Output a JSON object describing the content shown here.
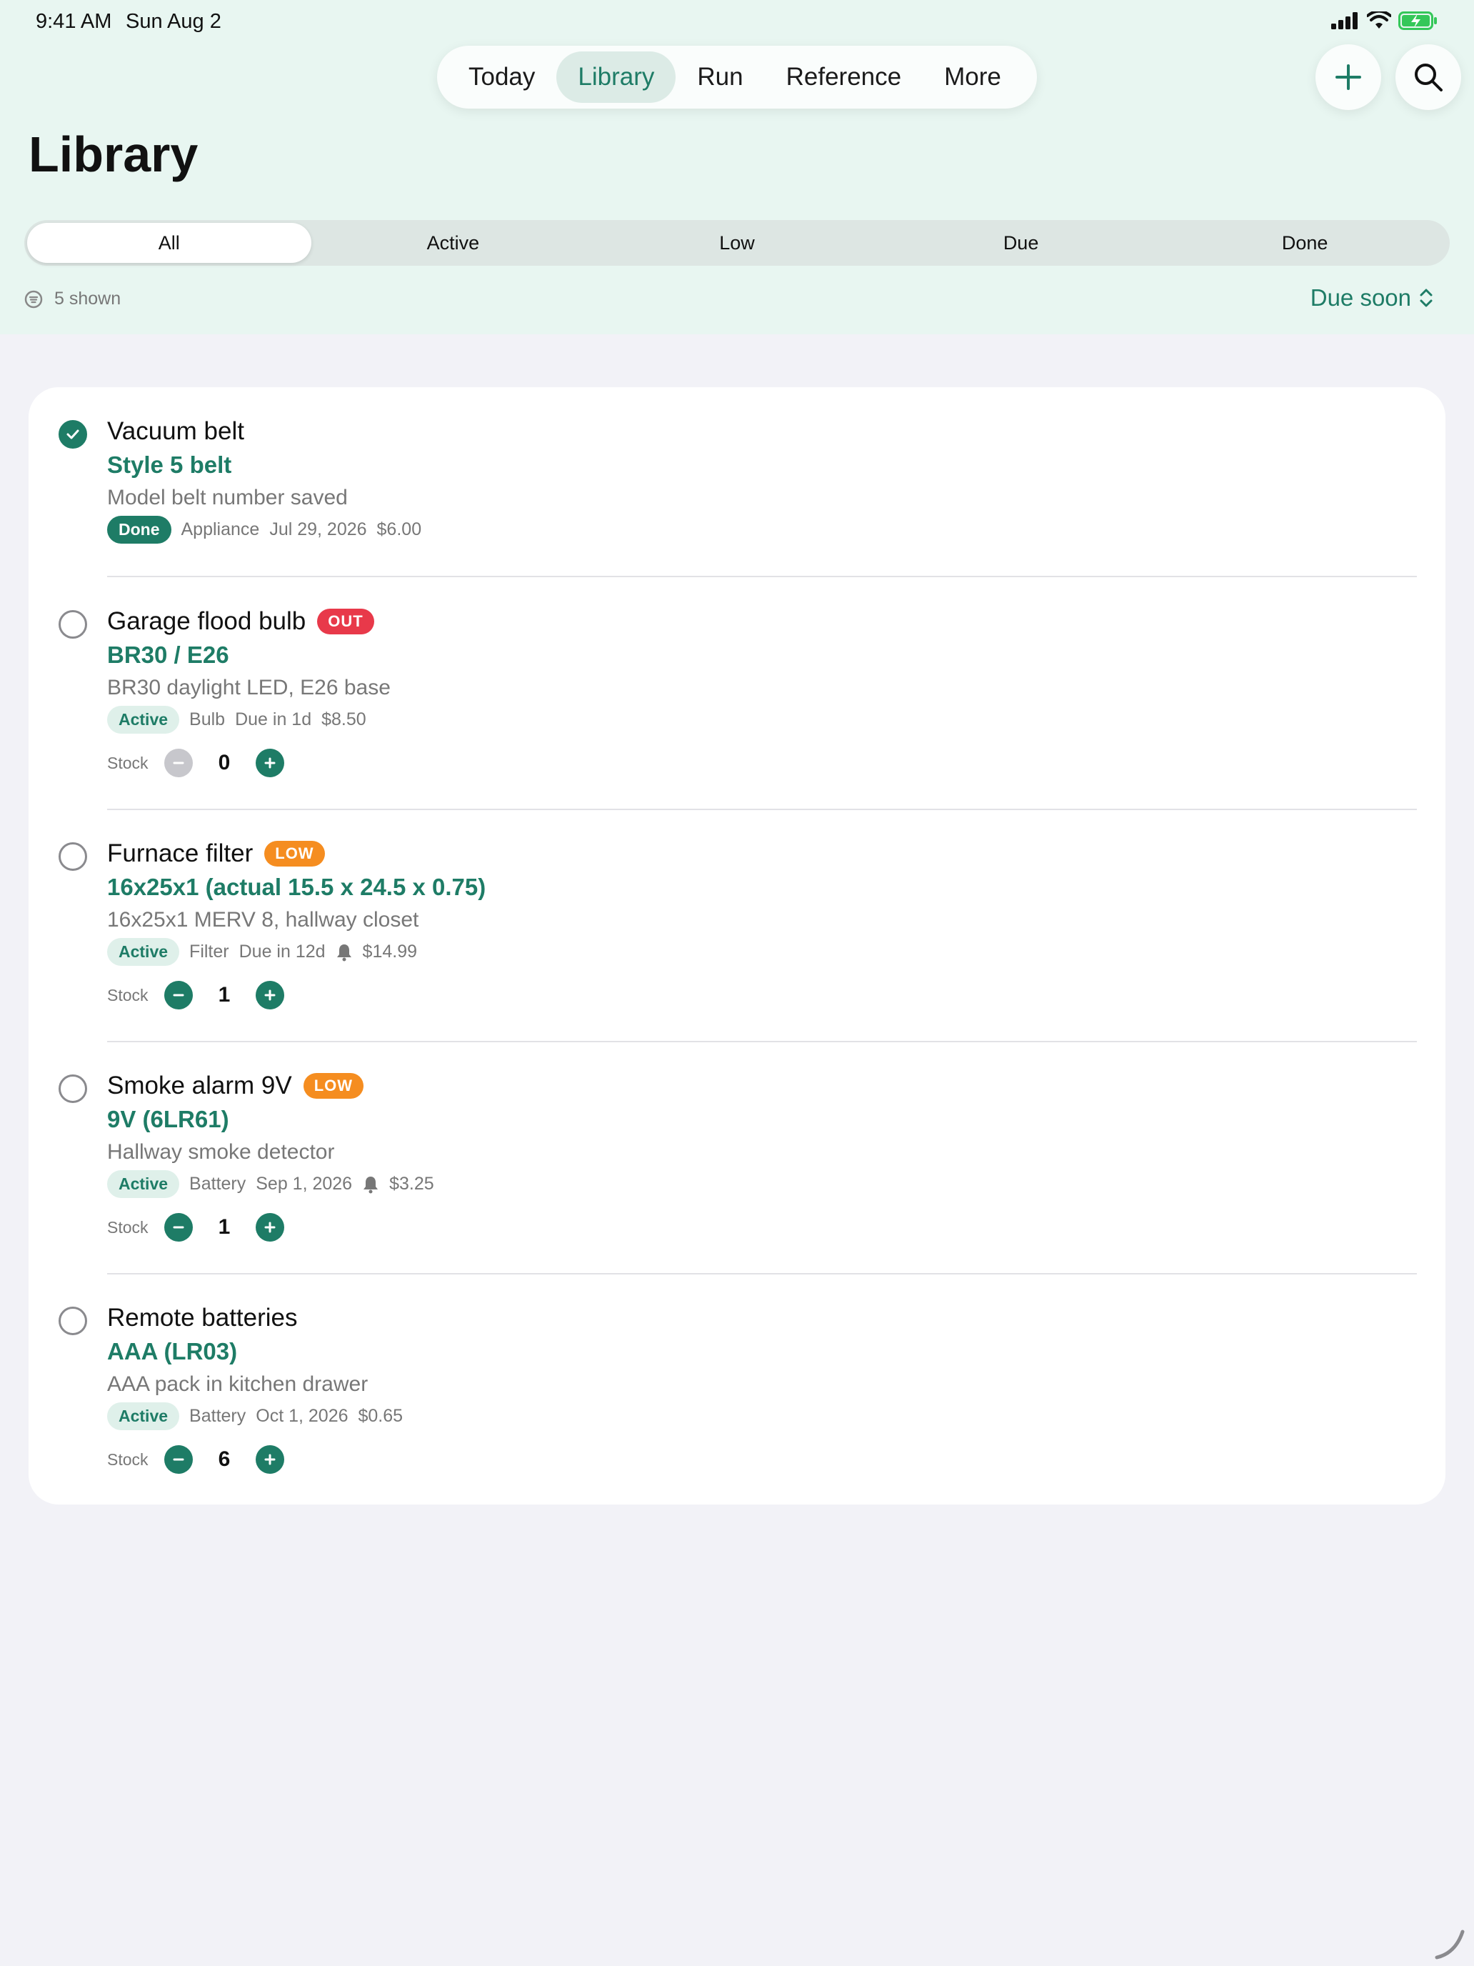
{
  "status_bar": {
    "time": "9:41 AM",
    "date": "Sun Aug 2"
  },
  "nav": {
    "tabs": [
      {
        "label": "Today"
      },
      {
        "label": "Library",
        "active": true
      },
      {
        "label": "Run"
      },
      {
        "label": "Reference"
      },
      {
        "label": "More"
      }
    ]
  },
  "page": {
    "title": "Library"
  },
  "filters": {
    "segments": [
      "All",
      "Active",
      "Low",
      "Due",
      "Done"
    ],
    "selected": "All"
  },
  "summary": {
    "shown": "5 shown",
    "sort": "Due soon"
  },
  "colors": {
    "accent": "#1e7c66",
    "out": "#e8394a",
    "low": "#f58d20",
    "background": "#e8f6f1"
  },
  "items": [
    {
      "title": "Vacuum belt",
      "badge": "",
      "subtitle": "Style 5 belt",
      "description": "Model belt number saved",
      "status": "Done",
      "category": "Appliance",
      "due": "Jul 29, 2026",
      "reminder": false,
      "price": "$6.00",
      "checked": true
    },
    {
      "title": "Garage flood bulb",
      "badge": "OUT",
      "subtitle": "BR30 / E26",
      "description": "BR30 daylight LED, E26 base",
      "status": "Active",
      "category": "Bulb",
      "due": "Due in 1d",
      "reminder": false,
      "price": "$8.50",
      "checked": false,
      "stock_label": "Stock",
      "stock": "0"
    },
    {
      "title": "Furnace filter",
      "badge": "LOW",
      "subtitle": "16x25x1 (actual 15.5 x 24.5 x 0.75)",
      "description": "16x25x1 MERV 8, hallway closet",
      "status": "Active",
      "category": "Filter",
      "due": "Due in 12d",
      "reminder": true,
      "price": "$14.99",
      "checked": false,
      "stock_label": "Stock",
      "stock": "1"
    },
    {
      "title": "Smoke alarm 9V",
      "badge": "LOW",
      "subtitle": "9V (6LR61)",
      "description": "Hallway smoke detector",
      "status": "Active",
      "category": "Battery",
      "due": "Sep 1, 2026",
      "reminder": true,
      "price": "$3.25",
      "checked": false,
      "stock_label": "Stock",
      "stock": "1"
    },
    {
      "title": "Remote batteries",
      "badge": "",
      "subtitle": "AAA (LR03)",
      "description": "AAA pack in kitchen drawer",
      "status": "Active",
      "category": "Battery",
      "due": "Oct 1, 2026",
      "reminder": false,
      "price": "$0.65",
      "checked": false,
      "stock_label": "Stock",
      "stock": "6"
    }
  ]
}
